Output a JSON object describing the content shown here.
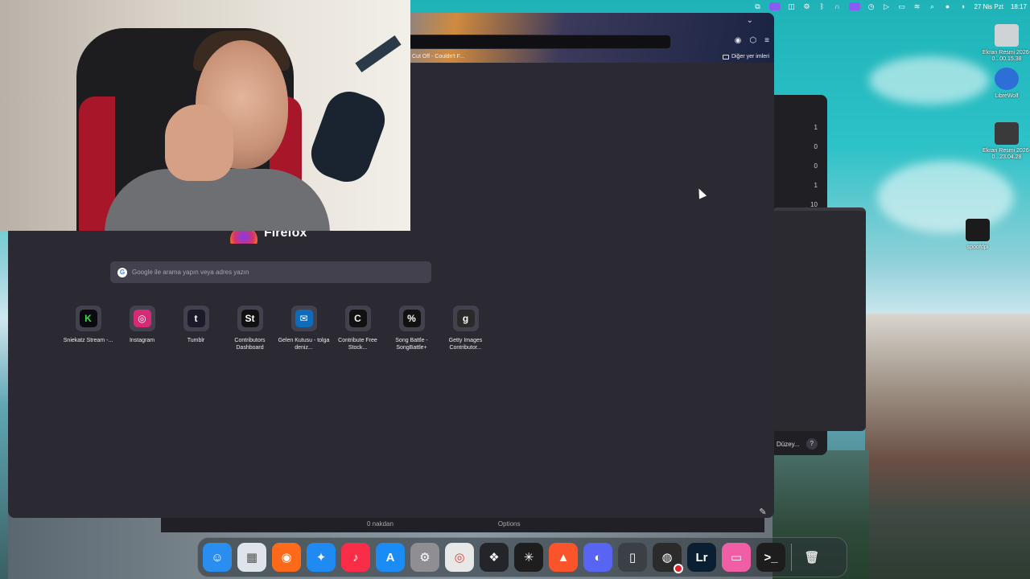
{
  "menubar": {
    "date": "27 Nis Pzt",
    "time": "18:17",
    "icons": [
      "screen-share-icon",
      "display-icon",
      "focus-icon",
      "settings-gear-icon",
      "bluetooth-icon",
      "headphones-icon",
      "window-icon",
      "clock-icon",
      "play-icon",
      "display-mirror-icon",
      "wifi-icon",
      "search-icon",
      "siri-icon",
      "control-center-icon"
    ]
  },
  "browser": {
    "bookmark": "Cut Off - Couldn't F...",
    "other_bookmarks": "Diğer yer imleri",
    "brand": "Firefox",
    "search_placeholder": "Google ile arama yapın veya adres yazın",
    "shortcuts": [
      {
        "label": "Sniekatz Stream -...",
        "icon": "K",
        "bg": "#0b0b0f",
        "fg": "#3bde45"
      },
      {
        "label": "Instagram",
        "icon": "◎",
        "bg": "#d62976",
        "fg": "#ffffff"
      },
      {
        "label": "Tumblr",
        "icon": "t",
        "bg": "#1a1a2a",
        "fg": "#ffffff"
      },
      {
        "label": "Contributors Dashboard",
        "icon": "St",
        "bg": "#111111",
        "fg": "#ffffff"
      },
      {
        "label": "Gelen Kutusu - tolga deniz...",
        "icon": "✉",
        "bg": "#0f6cbd",
        "fg": "#ffffff"
      },
      {
        "label": "Contribute Free Stock...",
        "icon": "C",
        "bg": "#111111",
        "fg": "#f0f0f0"
      },
      {
        "label": "Song Battle - SongBattle+",
        "icon": "%",
        "bg": "#111111",
        "fg": "#ffffff"
      },
      {
        "label": "Getty Images Contributor...",
        "icon": "g",
        "bg": "#2a2a2a",
        "fg": "#ffffff"
      }
    ]
  },
  "back_windows": {
    "counts": [
      "1",
      "0",
      "0",
      "1",
      "10"
    ],
    "partial_label": "Düzey...",
    "help": "?",
    "editor_text": "0 nakdan",
    "options": "Options"
  },
  "desktop": {
    "icons": [
      {
        "label": "Ekran Resmi 2026-0...00.15.38",
        "color": "#cfd3d6"
      },
      {
        "label": "LibreWolf",
        "color": "#2d6fd6"
      },
      {
        "label": "Ekran Resmi 2026-0...23.04.28",
        "color": "#3a3a3a"
      },
      {
        "label": "spoofdpi",
        "color": "#1b1b1b"
      }
    ]
  },
  "dock": {
    "apps": [
      {
        "name": "finder-icon",
        "glyph": "☺",
        "bg": "#2a8ef0"
      },
      {
        "name": "launchpad-icon",
        "glyph": "▦",
        "bg": "#dfe3ea"
      },
      {
        "name": "firefox-icon",
        "glyph": "◉",
        "bg": "#ff6a1a"
      },
      {
        "name": "safari-icon",
        "glyph": "✦",
        "bg": "#1f8bf2"
      },
      {
        "name": "music-icon",
        "glyph": "♪",
        "bg": "#fa2d48"
      },
      {
        "name": "app-store-icon",
        "glyph": "A",
        "bg": "#1b8cf5"
      },
      {
        "name": "system-settings-icon",
        "glyph": "⚙",
        "bg": "#8e8e93"
      },
      {
        "name": "chrome-icon",
        "glyph": "◎",
        "bg": "#e8e8e8"
      },
      {
        "name": "davinci-resolve-icon",
        "glyph": "❖",
        "bg": "#23252b"
      },
      {
        "name": "perplexity-icon",
        "glyph": "✳",
        "bg": "#1e1e1e"
      },
      {
        "name": "brave-icon",
        "glyph": "▲",
        "bg": "#fb542b"
      },
      {
        "name": "discord-icon",
        "glyph": "◐",
        "bg": "#5865f2"
      },
      {
        "name": "simulator-icon",
        "glyph": "▯",
        "bg": "#3b3f46"
      },
      {
        "name": "obs-icon",
        "glyph": "◍",
        "bg": "#2b2b2b"
      },
      {
        "name": "lightroom-icon",
        "glyph": "Lr",
        "bg": "#0b1f33"
      },
      {
        "name": "cleanmymac-icon",
        "glyph": "▭",
        "bg": "#f05fa5"
      },
      {
        "name": "terminal-icon",
        "glyph": ">_",
        "bg": "#1d1d1d"
      },
      {
        "name": "trash-icon",
        "glyph": "🗑",
        "bg": "transparent"
      }
    ]
  }
}
